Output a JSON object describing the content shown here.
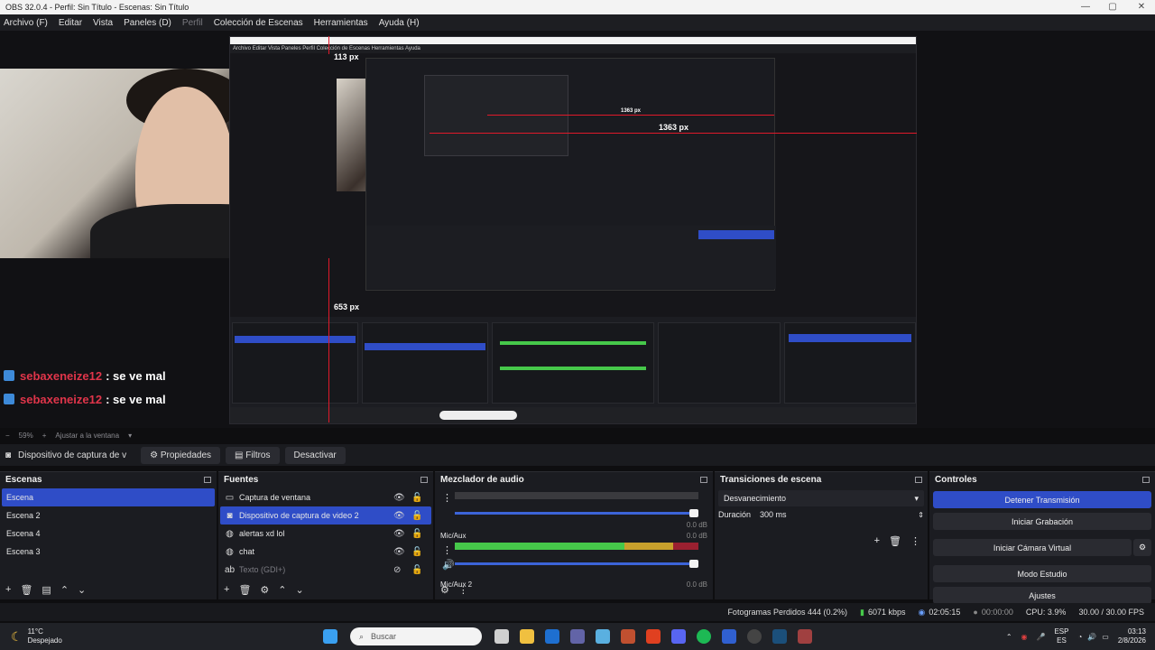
{
  "window": {
    "title": "OBS 32.0.4 - Perfil: Sin Título - Escenas: Sin Título"
  },
  "menu": [
    {
      "label": "Archivo (F)",
      "dim": false
    },
    {
      "label": "Editar",
      "dim": false
    },
    {
      "label": "Vista",
      "dim": false
    },
    {
      "label": "Paneles (D)",
      "dim": false
    },
    {
      "label": "Perfil",
      "dim": true
    },
    {
      "label": "Colección de Escenas",
      "dim": false
    },
    {
      "label": "Herramientas",
      "dim": false
    },
    {
      "label": "Ayuda (H)",
      "dim": false
    }
  ],
  "preview": {
    "px_label_top": "113 px",
    "px_label_right": "1363 px",
    "px_label_bottom": "653 px",
    "inner_px_label": "1363 px"
  },
  "chat": [
    {
      "user": "sebaxeneize12",
      "msg": ": se ve mal"
    },
    {
      "user": "sebaxeneize12",
      "msg": ": se ve mal"
    }
  ],
  "zoom": {
    "value": "59%",
    "fit": "Ajustar a la ventana"
  },
  "source_bar": {
    "selected": "Dispositivo de captura de v",
    "properties": "Propiedades",
    "filters": "Filtros",
    "deactivate": "Desactivar"
  },
  "scenes": {
    "title": "Escenas",
    "items": [
      {
        "label": "Escena",
        "selected": true
      },
      {
        "label": "Escena 2",
        "selected": false
      },
      {
        "label": "Escena 4",
        "selected": false
      },
      {
        "label": "Escena 3",
        "selected": false
      }
    ]
  },
  "sources": {
    "title": "Fuentes",
    "items": [
      {
        "label": "Captura de ventana",
        "icon": "window-icon",
        "selected": false,
        "dim": false
      },
      {
        "label": "Dispositivo de captura de video 2",
        "icon": "camera-icon",
        "selected": true,
        "dim": false
      },
      {
        "label": "alertas xd lol",
        "icon": "globe-icon",
        "selected": false,
        "dim": false
      },
      {
        "label": "chat",
        "icon": "globe-icon",
        "selected": false,
        "dim": false
      },
      {
        "label": "Texto (GDI+)",
        "icon": "text-icon",
        "selected": false,
        "dim": true
      }
    ]
  },
  "mixer": {
    "title": "Mezclador de audio",
    "scale": [
      "-60",
      "-55",
      "-50",
      "-45",
      "-40",
      "-35",
      "-30",
      "-25",
      "-20",
      "-15",
      "-10",
      "-5",
      "0"
    ],
    "channels": [
      {
        "name": "",
        "db": "0.0 dB",
        "level": 0.0
      },
      {
        "name": "Mic/Aux",
        "db": "0.0 dB",
        "level": 0.72
      },
      {
        "name": "Mic/Aux 2",
        "db": "0.0 dB",
        "level": 0.0
      }
    ]
  },
  "transitions": {
    "title": "Transiciones de escena",
    "type": "Desvanecimiento",
    "duration_label": "Duración",
    "duration": "300 ms"
  },
  "controls": {
    "title": "Controles",
    "buttons": [
      {
        "label": "Detener Transmisión",
        "primary": true
      },
      {
        "label": "Iniciar Grabación",
        "primary": false
      },
      {
        "label": "Iniciar Cámara Virtual",
        "primary": false
      },
      {
        "label": "Modo Estudio",
        "primary": false
      },
      {
        "label": "Ajustes",
        "primary": false
      }
    ]
  },
  "status": {
    "dropped": "Fotogramas Perdidos 444 (0.2%)",
    "bitrate": "6071 kbps",
    "stream_time": "02:05:15",
    "rec_time": "00:00:00",
    "cpu": "CPU: 3.9%",
    "fps": "30.00 / 30.00 FPS"
  },
  "taskbar": {
    "weather_temp": "11°C",
    "weather_desc": "Despejado",
    "search": "Buscar",
    "lang": "ESP",
    "lang2": "ES",
    "time": "03:13",
    "date": "2/8/2026"
  }
}
